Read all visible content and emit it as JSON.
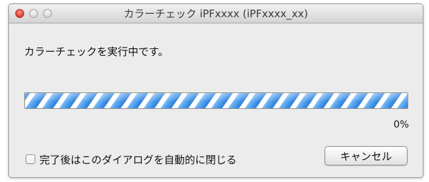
{
  "window": {
    "title": "カラーチェック iPFxxxx (iPFxxxx_xx)"
  },
  "dialog": {
    "message": "カラーチェックを実行中です。",
    "progress_percent_text": "0%",
    "progress_value": 0,
    "checkbox_label": "完了後はこのダイアログを自動的に閉じる",
    "checkbox_checked": false,
    "cancel_label": "キャンセル"
  },
  "colors": {
    "progress_stripe": "#2c7fdc",
    "close_button": "#e0443a"
  },
  "icons": {
    "close": "close-traffic-light",
    "minimize": "minimize-traffic-light",
    "zoom": "zoom-traffic-light"
  }
}
